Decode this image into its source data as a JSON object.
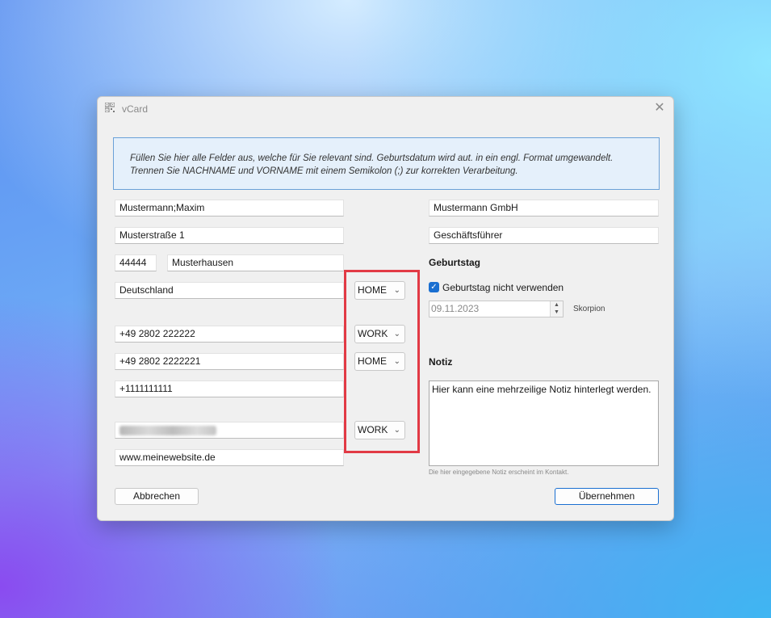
{
  "window": {
    "title": "vCard",
    "close_glyph": "✕"
  },
  "info": {
    "line1": "Füllen Sie hier alle Felder aus, welche für Sie relevant sind. Geburtsdatum wird aut. in ein engl. Format umgewandelt.",
    "line2": "Trennen Sie NACHNAME und VORNAME mit einem Semikolon (;) zur korrekten Verarbeitung."
  },
  "fields": {
    "name": "Mustermann;Maxim",
    "street": "Musterstraße 1",
    "zip": "44444",
    "city": "Musterhausen",
    "country": "Deutschland",
    "phone1": "+49 2802 222222",
    "phone2": "+49 2802 2222221",
    "phone3": "+1111111111",
    "email": "",
    "website": "www.meinewebsite.de",
    "company": "Mustermann GmbH",
    "job_title": "Geschäftsführer"
  },
  "combos": {
    "address_type": "HOME",
    "phone1_type": "WORK",
    "phone2_type": "HOME",
    "email_type": "WORK"
  },
  "birthday": {
    "heading": "Geburtstag",
    "checkbox_label": "Geburtstag nicht verwenden",
    "checked": true,
    "date": "09.11.2023",
    "zodiac": "Skorpion"
  },
  "note": {
    "heading": "Notiz",
    "text": "Hier kann eine mehrzeilige Notiz hinterlegt werden.",
    "hint": "Die hier eingegebene Notiz erscheint im Kontakt."
  },
  "buttons": {
    "cancel": "Abbrechen",
    "apply": "Übernehmen"
  },
  "colors": {
    "accent": "#1a6fd1",
    "highlight": "#e23a45",
    "info_bg": "#e5f0fb",
    "info_border": "#6aa1d8"
  }
}
